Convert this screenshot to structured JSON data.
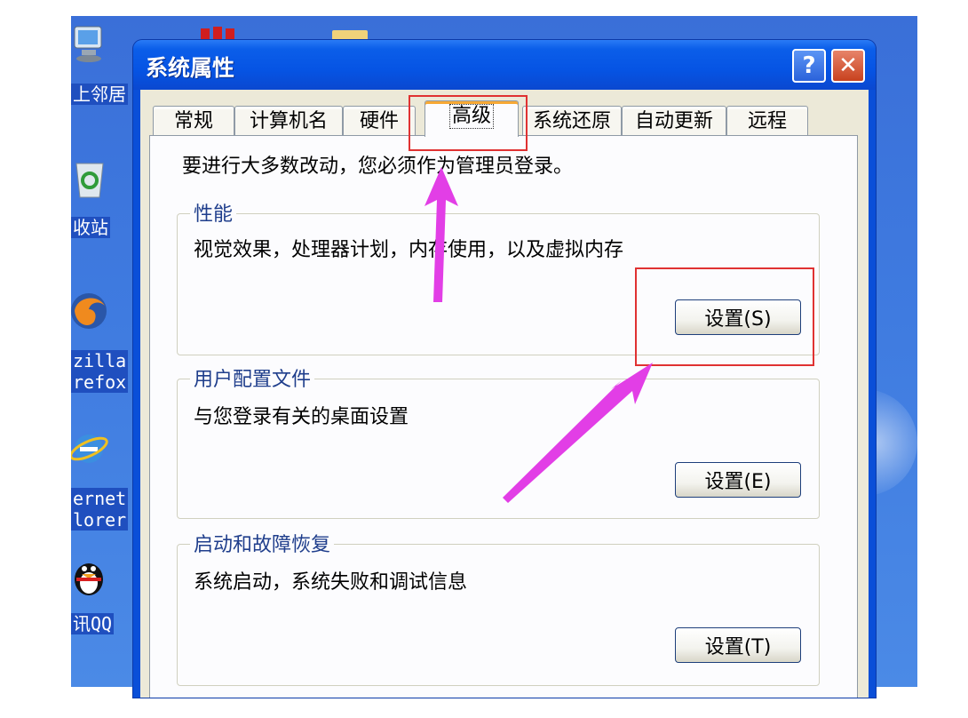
{
  "desktop": {
    "icons": [
      {
        "name": "network-places",
        "label": "上邻居"
      },
      {
        "name": "recycle-bin",
        "label": "收站"
      },
      {
        "name": "firefox",
        "label": "zilla\nrefox"
      },
      {
        "name": "internet-explorer",
        "label": "ernet\nlorer"
      },
      {
        "name": "qq",
        "label": "讯QQ"
      }
    ]
  },
  "window": {
    "title": "系统属性",
    "help_label": "?",
    "close_label": "✕",
    "tabs": [
      {
        "label": "常规"
      },
      {
        "label": "计算机名"
      },
      {
        "label": "硬件"
      },
      {
        "label": "高级"
      },
      {
        "label": "系统还原"
      },
      {
        "label": "自动更新"
      },
      {
        "label": "远程"
      }
    ],
    "active_tab": "高级",
    "admin_note": "要进行大多数改动，您必须作为管理员登录。",
    "groups": [
      {
        "title": "性能",
        "description": "视觉效果，处理器计划，内存使用，以及虚拟内存",
        "button": "设置(S)"
      },
      {
        "title": "用户配置文件",
        "description": "与您登录有关的桌面设置",
        "button": "设置(E)"
      },
      {
        "title": "启动和故障恢复",
        "description": "系统启动，系统失败和调试信息",
        "button": "设置(T)"
      }
    ]
  },
  "annotations": {
    "highlight_color": "#e03232",
    "arrow_color": "#e23ee6"
  }
}
